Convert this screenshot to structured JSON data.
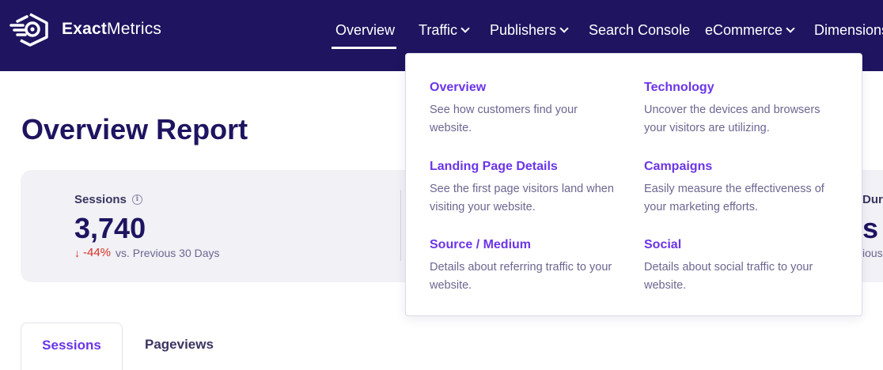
{
  "brand": {
    "name_bold": "Exact",
    "name_rest": "Metrics"
  },
  "nav": {
    "items": [
      {
        "label": "Overview",
        "has_dropdown": false
      },
      {
        "label": "Traffic",
        "has_dropdown": true
      },
      {
        "label": "Publishers",
        "has_dropdown": true
      },
      {
        "label": "Search Console",
        "has_dropdown": false
      },
      {
        "label": "eCommerce",
        "has_dropdown": true
      },
      {
        "label": "Dimensions",
        "has_dropdown": false
      }
    ],
    "active": "Overview"
  },
  "page": {
    "title": "Overview Report"
  },
  "stats": {
    "sessions": {
      "label": "Sessions",
      "value": "3,740",
      "change": "-44%",
      "change_text": "vs. Previous 30 Days"
    },
    "clipped": {
      "label": "Durat",
      "value": "s",
      "text": "ious"
    }
  },
  "dropdown": {
    "items": [
      {
        "title": "Overview",
        "desc_1": "See how customers find your",
        "desc_2": "website."
      },
      {
        "title": "Technology",
        "desc_1": "Uncover the devices and browsers",
        "desc_2": "your visitors are utilizing."
      },
      {
        "title": "Landing Page Details",
        "desc_1": "See the first page visitors land when",
        "desc_2": "visiting your website."
      },
      {
        "title": "Campaigns",
        "desc_1": "Easily measure the effectiveness of",
        "desc_2": "your marketing efforts."
      },
      {
        "title": "Source / Medium",
        "desc_1": "Details about referring traffic to your",
        "desc_2": "website."
      },
      {
        "title": "Social",
        "desc_1": "Details about social traffic to your",
        "desc_2": "website."
      }
    ]
  },
  "tabs": [
    {
      "label": "Sessions",
      "active": true
    },
    {
      "label": "Pageviews",
      "active": false
    }
  ],
  "colors": {
    "header_bg": "#1e1460",
    "accent": "#6b35e8",
    "negative": "#d93025",
    "card_bg": "#f1f1f6"
  },
  "icons": {
    "logo": "exactmetrics-logo-icon",
    "info": "info-icon",
    "change": "arrow-down-icon",
    "chevron": "chevron-down-icon"
  }
}
